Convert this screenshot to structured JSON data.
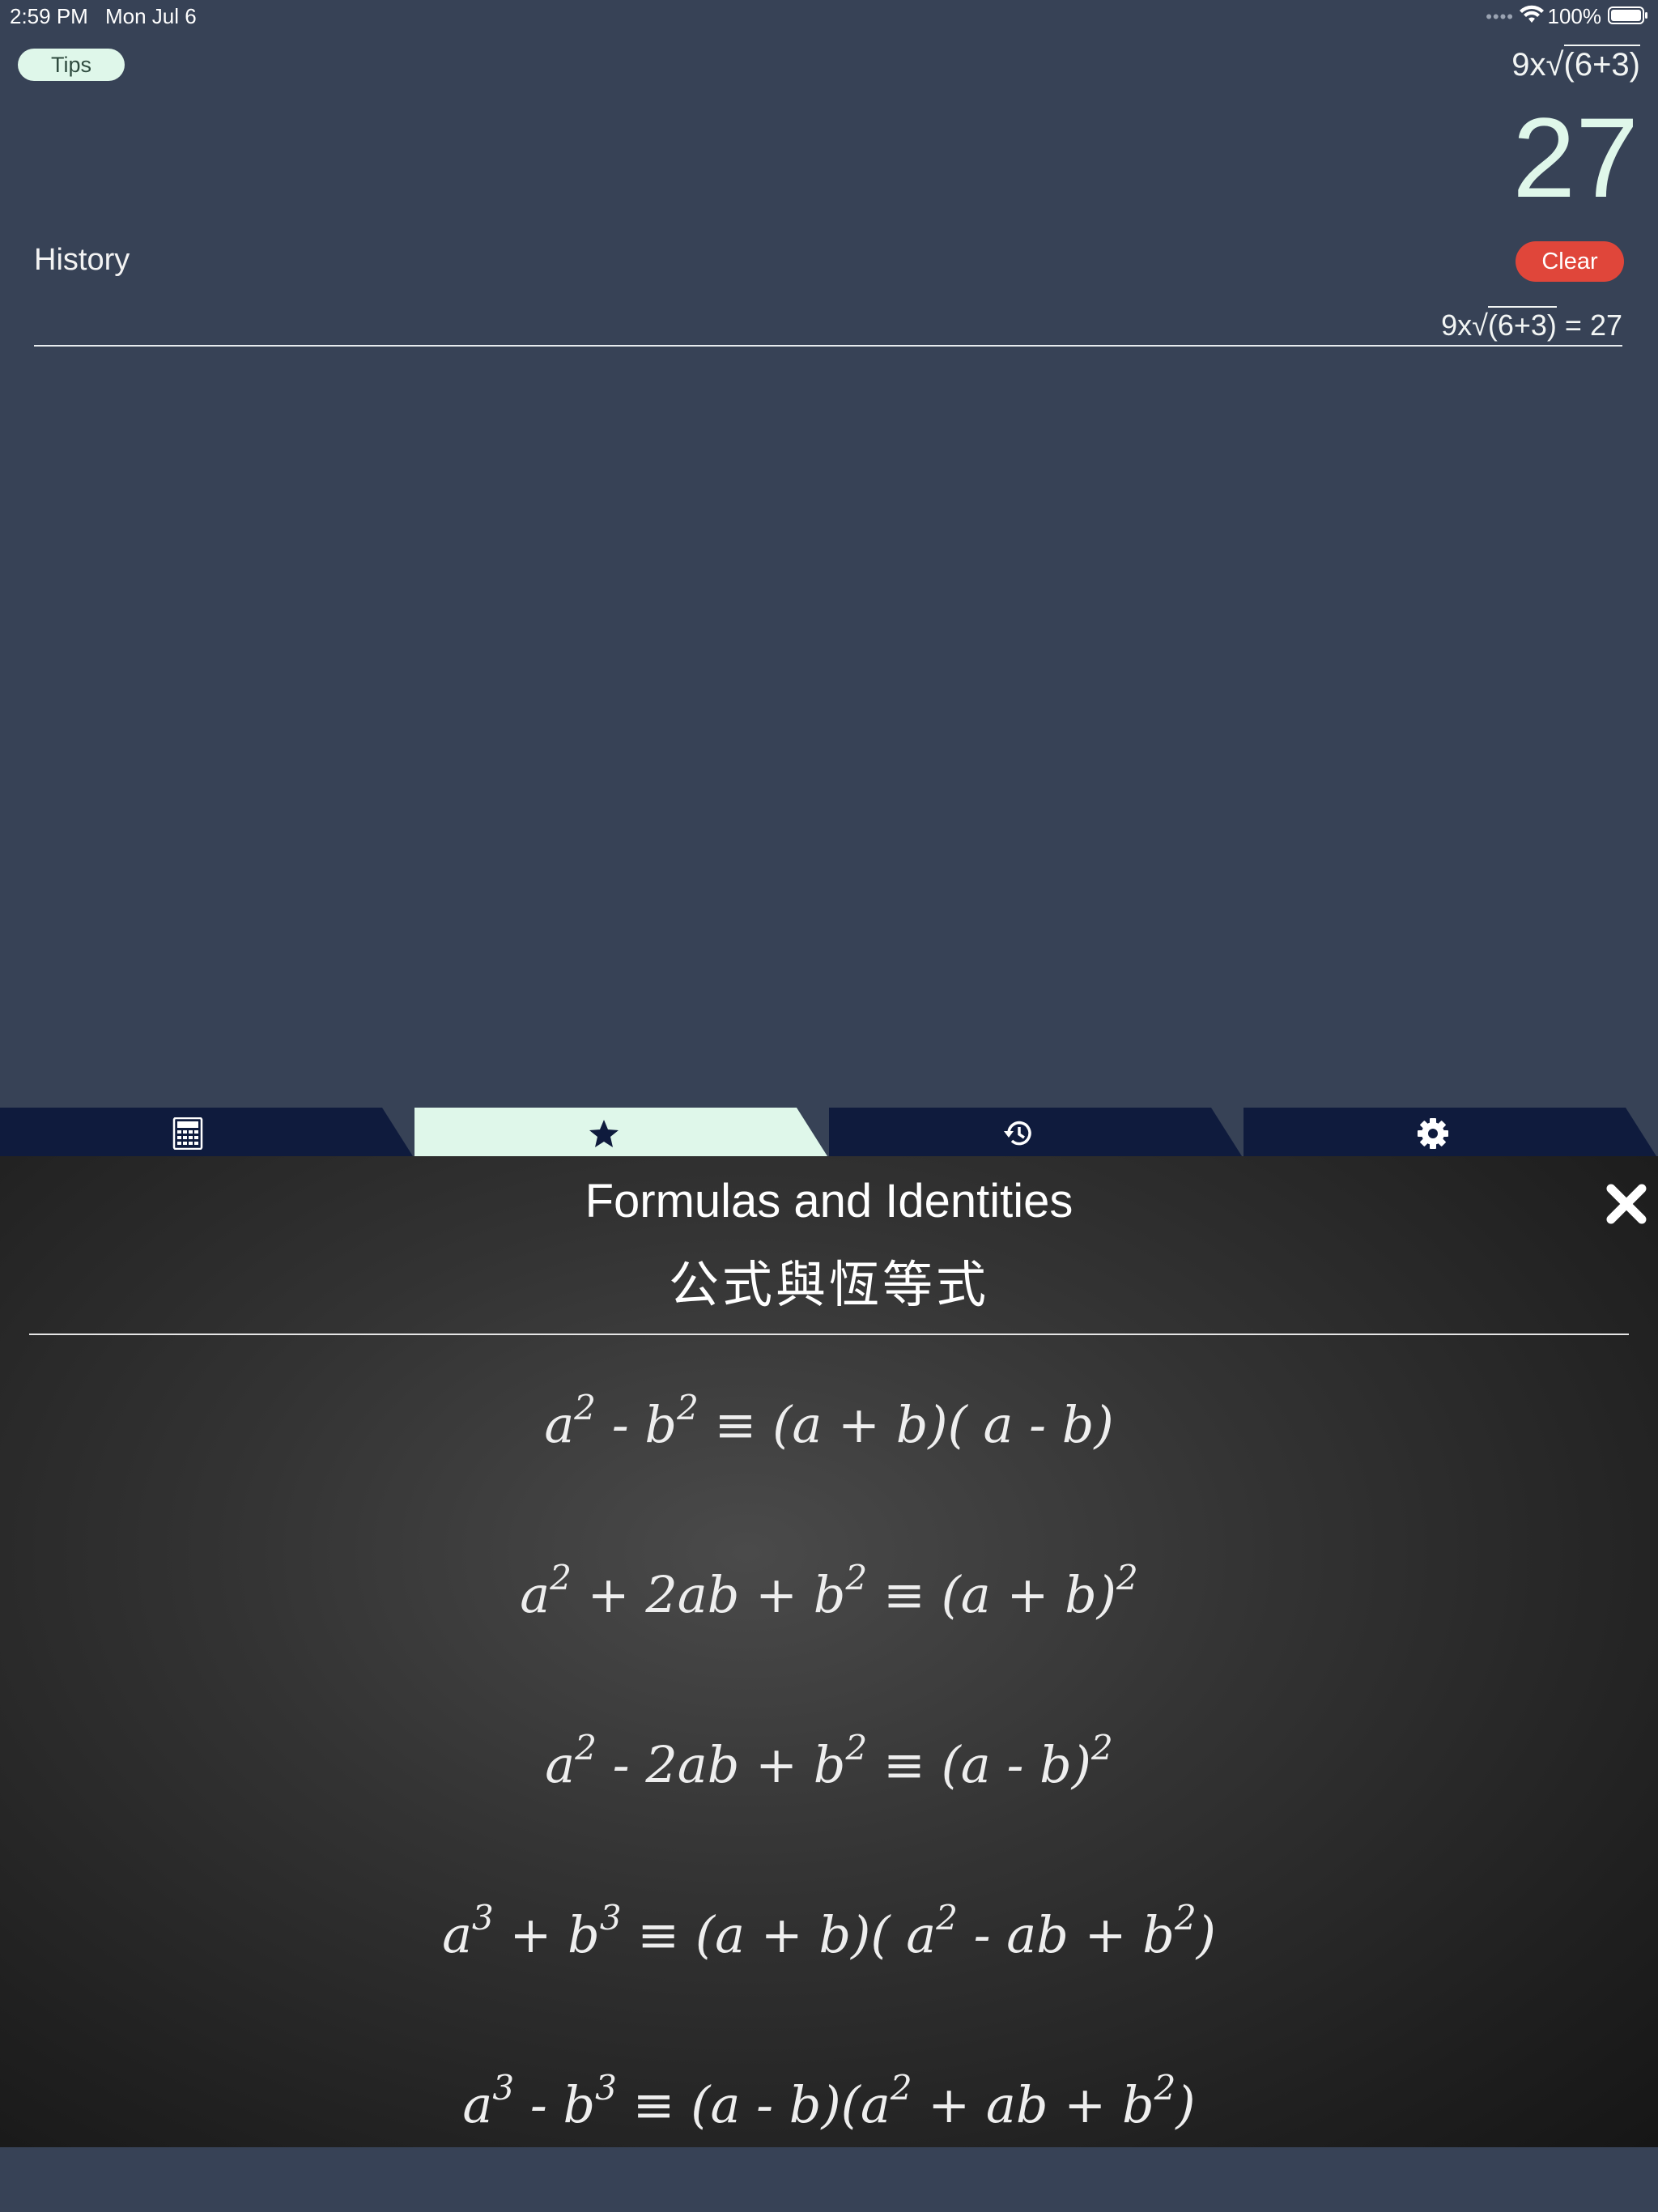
{
  "status_bar": {
    "time": "2:59 PM",
    "date": "Mon Jul 6",
    "battery": "100%"
  },
  "top": {
    "tips_label": "Tips",
    "expression_prefix": "9x√",
    "expression_radicand": "(6+3)",
    "result": "27"
  },
  "history": {
    "title": "History",
    "clear_label": "Clear",
    "entries": [
      {
        "prefix": "9x√",
        "radicand": "(6+3)",
        "suffix": " = 27"
      }
    ]
  },
  "tabs": [
    {
      "name": "calculator",
      "icon": "calculator-icon",
      "active": false
    },
    {
      "name": "formulas",
      "icon": "star-icon",
      "active": true
    },
    {
      "name": "history",
      "icon": "history-icon",
      "active": false
    },
    {
      "name": "settings",
      "icon": "gear-icon",
      "active": false
    }
  ],
  "panel": {
    "title": "Formulas and Identities",
    "subtitle": "公式與恆等式",
    "formulas": [
      "a2 - b2 ≡ (a + b)( a - b)",
      "a2 + 2ab + b2 ≡ (a + b)2",
      "a2 - 2ab + b2 ≡ (a - b)2",
      "a3 + b3 ≡ (a + b)( a2 - ab + b2)",
      "a3 - b3 ≡ (a - b)(a2 + ab + b2)"
    ]
  },
  "colors": {
    "background": "#374256",
    "tab_dark": "#0f1b3d",
    "tab_active": "#dff7ea",
    "accent_mint": "#dff7ea",
    "clear_red": "#e0463a"
  }
}
